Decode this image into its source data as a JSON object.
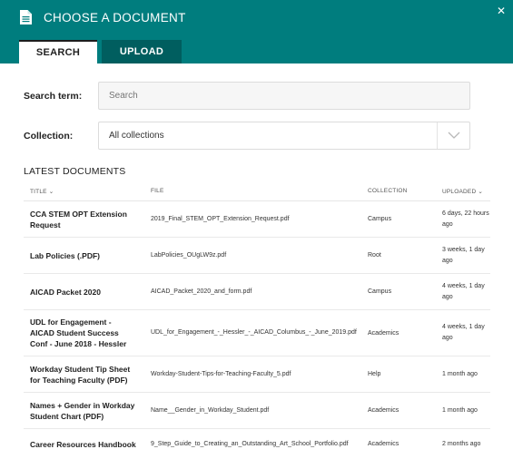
{
  "dialog": {
    "title": "CHOOSE A DOCUMENT",
    "icon": "document-icon",
    "close_icon": "close-icon",
    "accent_color": "#007d7e"
  },
  "tabs": [
    {
      "label": "SEARCH",
      "active": true
    },
    {
      "label": "UPLOAD",
      "active": false
    }
  ],
  "search": {
    "label": "Search term:",
    "placeholder": "Search",
    "value": ""
  },
  "collection": {
    "label": "Collection:",
    "selected": "All collections"
  },
  "latest": {
    "heading": "LATEST DOCUMENTS",
    "columns": {
      "title": "TITLE",
      "file": "FILE",
      "collection": "COLLECTION",
      "uploaded": "UPLOADED"
    },
    "rows": [
      {
        "title": "CCA STEM OPT Extension Request",
        "file": "2019_Final_STEM_OPT_Extension_Request.pdf",
        "collection": "Campus",
        "uploaded": "6 days, 22 hours ago"
      },
      {
        "title": "Lab Policies (.PDF)",
        "file": "LabPolicies_OUgLW9z.pdf",
        "collection": "Root",
        "uploaded": "3 weeks, 1 day ago"
      },
      {
        "title": "AICAD Packet 2020",
        "file": "AICAD_Packet_2020_and_form.pdf",
        "collection": "Campus",
        "uploaded": "4 weeks, 1 day ago"
      },
      {
        "title": "UDL for Engagement - AICAD Student Success Conf - June 2018 - Hessler",
        "file": "UDL_for_Engagement_-_Hessler_-_AICAD_Columbus_-_June_2019.pdf",
        "collection": "Academics",
        "uploaded": "4 weeks, 1 day ago"
      },
      {
        "title": "Workday Student Tip Sheet for Teaching Faculty (PDF)",
        "file": "Workday-Student-Tips-for-Teaching-Faculty_5.pdf",
        "collection": "Help",
        "uploaded": "1 month ago"
      },
      {
        "title": "Names + Gender in Workday Student Chart (PDF)",
        "file": "Name__Gender_in_Workday_Student.pdf",
        "collection": "Academics",
        "uploaded": "1 month ago"
      },
      {
        "title": "Career Resources Handbook",
        "file": "9_Step_Guide_to_Creating_an_Outstanding_Art_School_Portfolio.pdf",
        "collection": "Academics",
        "uploaded": "2 months ago"
      }
    ]
  }
}
